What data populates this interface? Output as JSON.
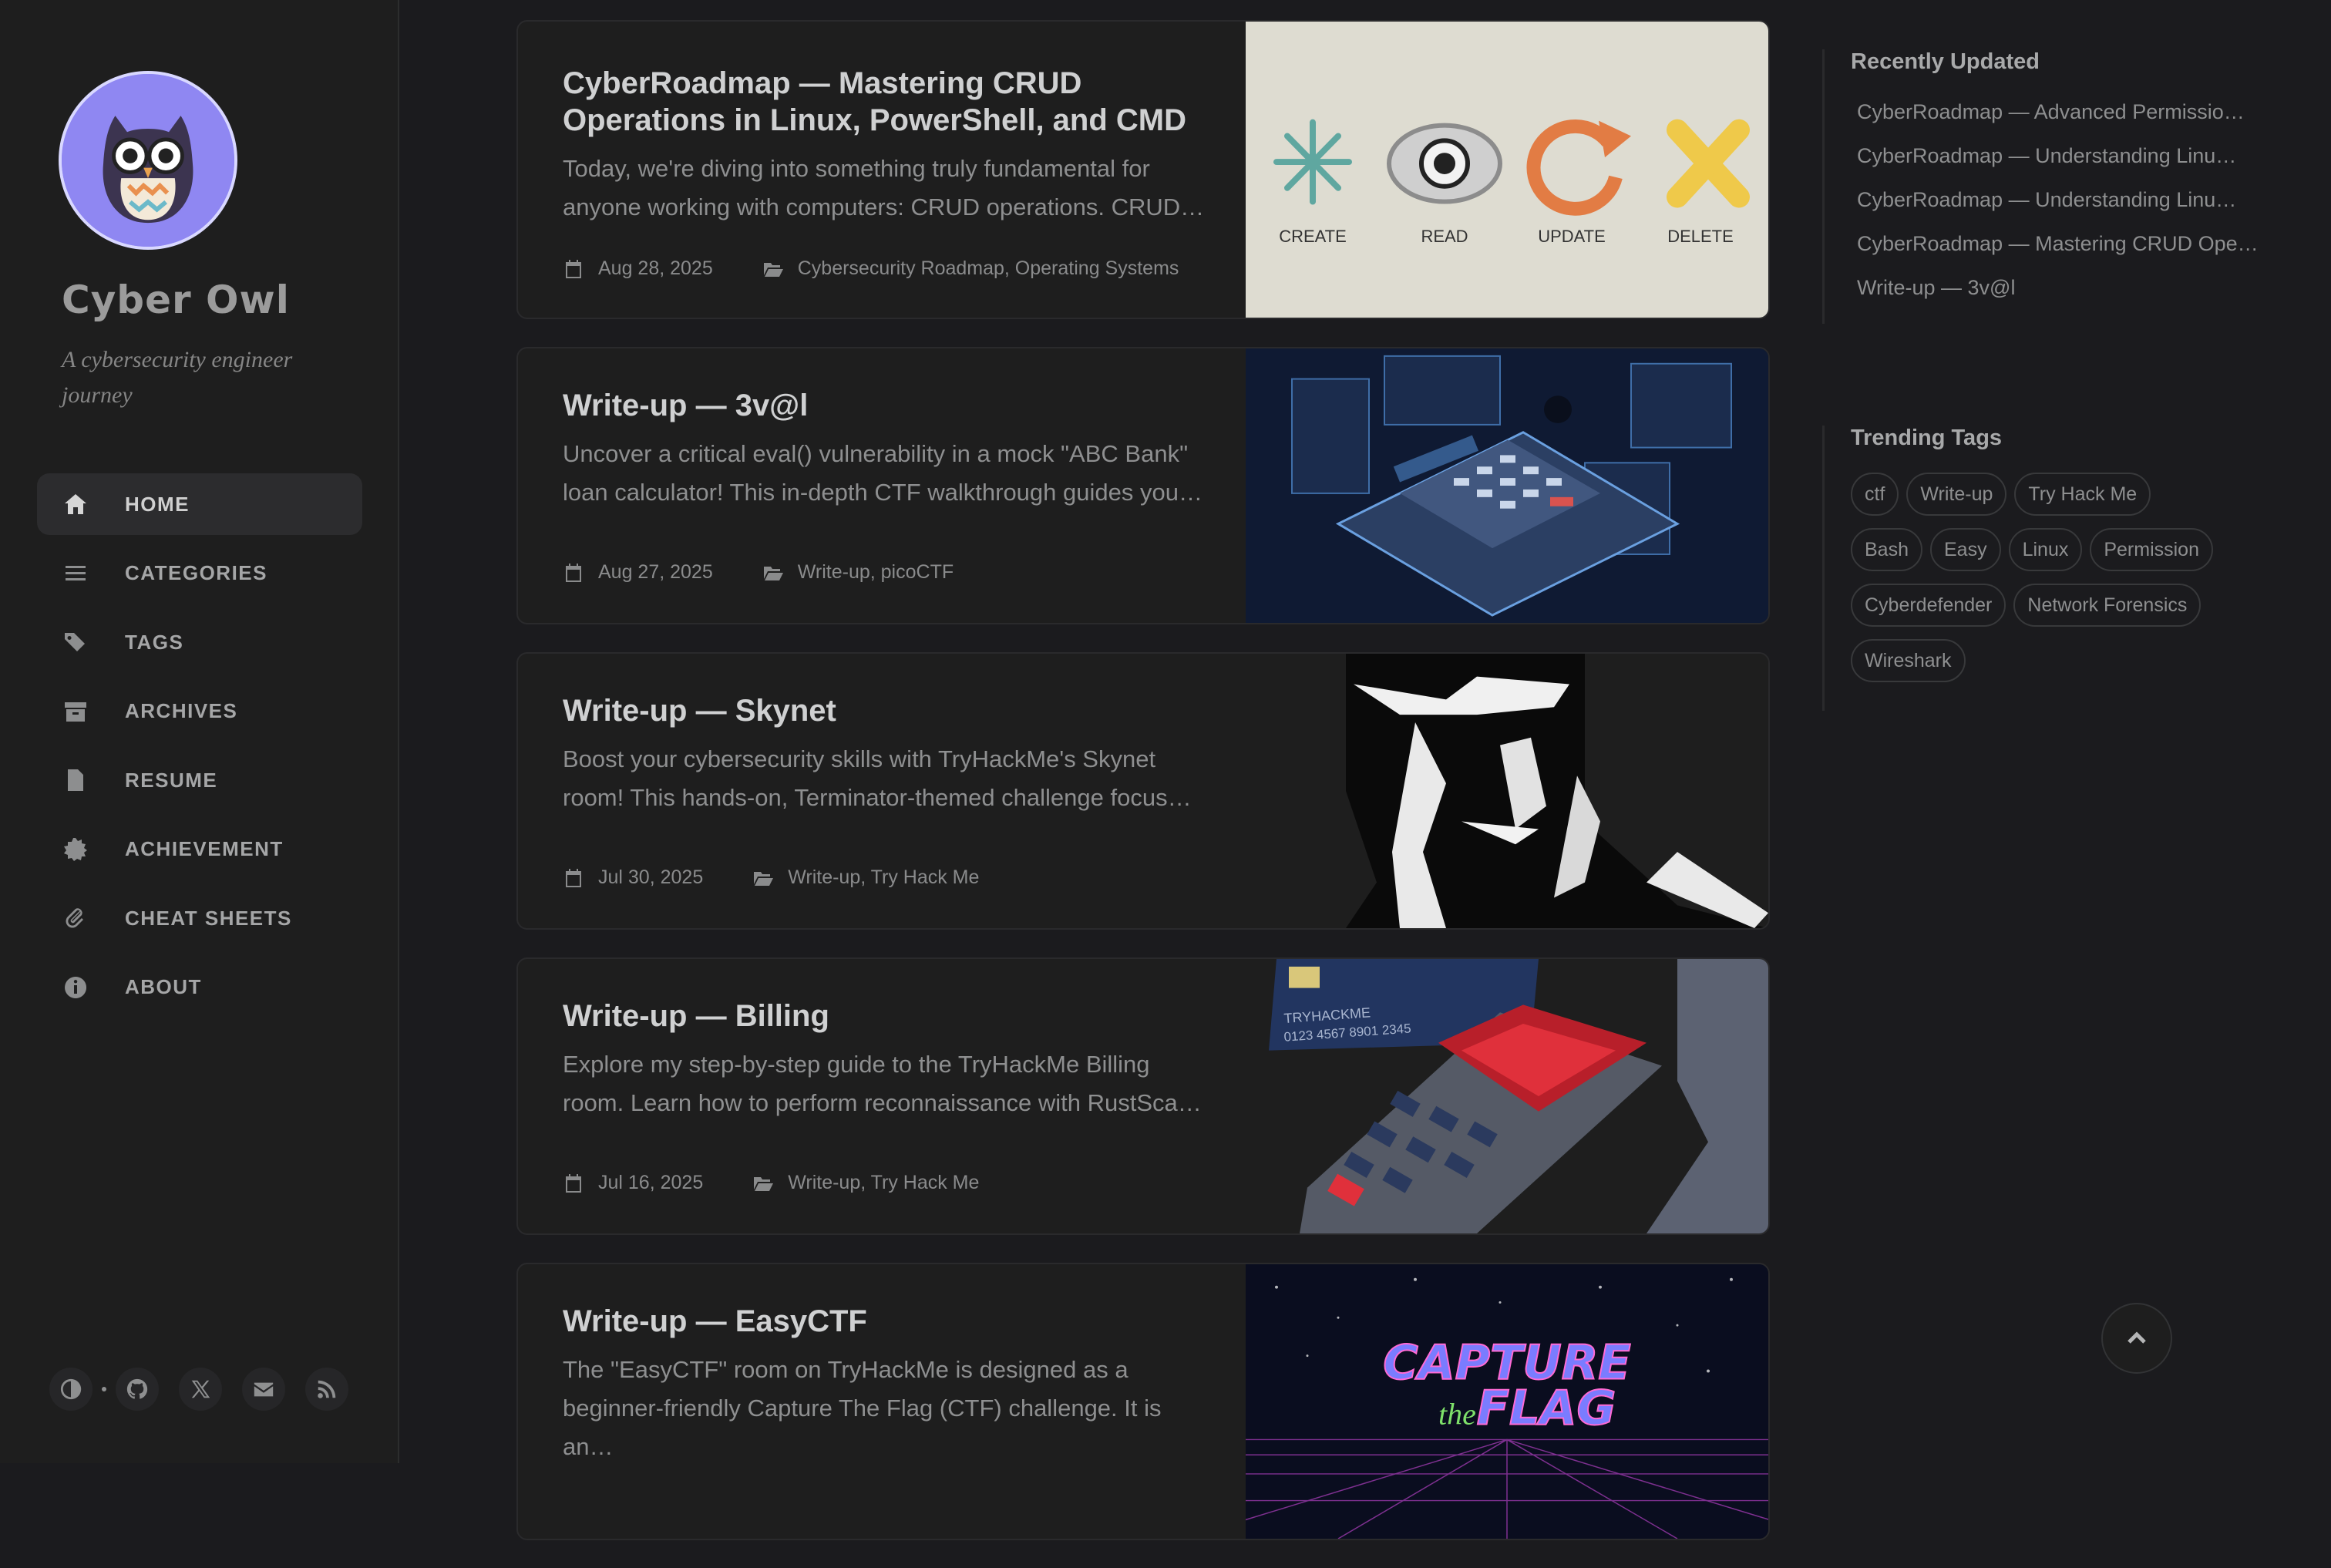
{
  "site": {
    "title": "Cyber Owl",
    "subtitle": "A cybersecurity engineer journey"
  },
  "nav": [
    {
      "label": "HOME",
      "icon": "home-icon",
      "active": true
    },
    {
      "label": "CATEGORIES",
      "icon": "stream-icon"
    },
    {
      "label": "TAGS",
      "icon": "tags-icon"
    },
    {
      "label": "ARCHIVES",
      "icon": "archive-icon"
    },
    {
      "label": "RESUME",
      "icon": "file-icon"
    },
    {
      "label": "ACHIEVEMENT",
      "icon": "certificate-icon"
    },
    {
      "label": "CHEAT SHEETS",
      "icon": "paperclip-icon"
    },
    {
      "label": "ABOUT",
      "icon": "info-icon"
    }
  ],
  "sidebar_buttons": [
    "theme-toggle-icon",
    "github-icon",
    "x-twitter-icon",
    "email-icon",
    "rss-icon"
  ],
  "posts": [
    {
      "title": "CyberRoadmap — Mastering CRUD Operations in Linux, PowerShell, and CMD",
      "excerpt": "Today, we're diving into something truly fundamental for anyone working with computers: CRUD operations. CRUD…",
      "date": "Aug 28, 2025",
      "categories": "Cybersecurity Roadmap, Operating Systems",
      "image_labels": [
        "CREATE",
        "READ",
        "UPDATE",
        "DELETE"
      ]
    },
    {
      "title": "Write-up — 3v@l",
      "excerpt": "Uncover a critical eval() vulnerability in a mock \"ABC Bank\" loan calculator! This in-depth CTF walkthrough guides you…",
      "date": "Aug 27, 2025",
      "categories": "Write-up, picoCTF"
    },
    {
      "title": "Write-up — Skynet",
      "excerpt": "Boost your cybersecurity skills with TryHackMe's Skynet room! This hands-on, Terminator-themed challenge focus…",
      "date": "Jul 30, 2025",
      "categories": "Write-up, Try Hack Me"
    },
    {
      "title": "Write-up — Billing",
      "excerpt": "Explore my step-by-step guide to the TryHackMe Billing room. Learn how to perform reconnaissance with RustSca…",
      "date": "Jul 16, 2025",
      "categories": "Write-up, Try Hack Me",
      "image_labels": [
        "TRYHACKME",
        "0123 4567 8901 2345"
      ]
    },
    {
      "title": "Write-up — EasyCTF",
      "excerpt": "The \"EasyCTF\" room on TryHackMe is designed as a beginner-friendly Capture The Flag (CTF) challenge. It is an…",
      "image_labels": [
        "CAPTURE",
        "the",
        "FLAG"
      ]
    }
  ],
  "recently_updated": {
    "title": "Recently Updated",
    "items": [
      "CyberRoadmap — Advanced Permissio…",
      "CyberRoadmap — Understanding Linu…",
      "CyberRoadmap — Understanding Linu…",
      "CyberRoadmap — Mastering CRUD Ope…",
      "Write-up — 3v@l"
    ]
  },
  "trending_tags": {
    "title": "Trending Tags",
    "items": [
      "ctf",
      "Write-up",
      "Try Hack Me",
      "Bash",
      "Easy",
      "Linux",
      "Permission",
      "Cyberdefender",
      "Network Forensics",
      "Wireshark"
    ]
  }
}
